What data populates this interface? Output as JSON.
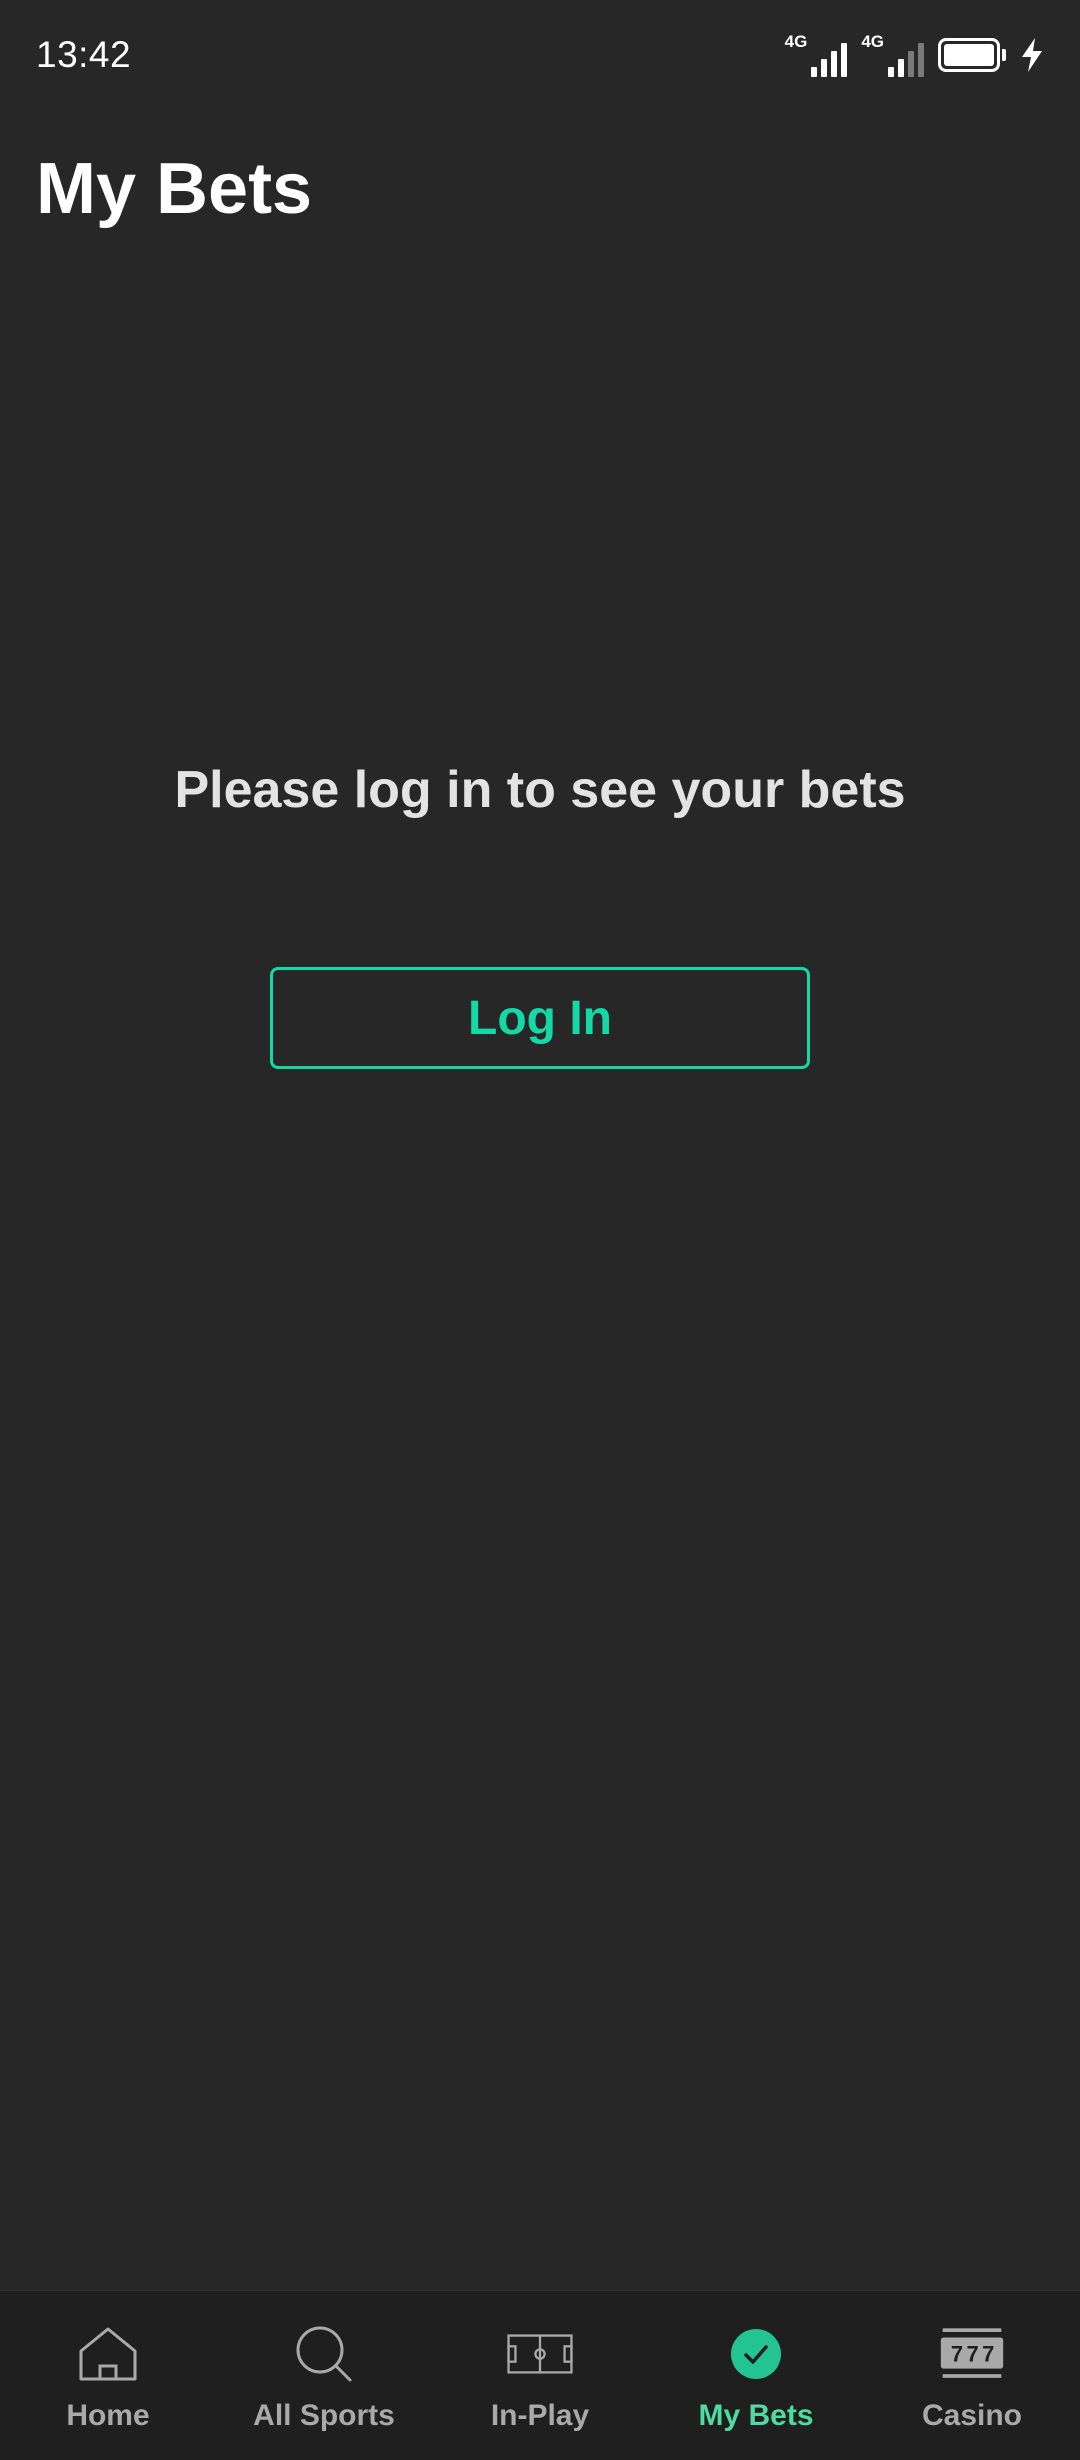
{
  "status_bar": {
    "time": "13:42",
    "network_1": "4G",
    "network_2": "4G"
  },
  "page": {
    "title": "My Bets",
    "prompt": "Please log in to see your bets",
    "login_label": "Log In"
  },
  "bottom_nav": {
    "items": [
      {
        "label": "Home",
        "icon": "home-icon"
      },
      {
        "label": "All Sports",
        "icon": "search-icon"
      },
      {
        "label": "In-Play",
        "icon": "pitch-icon"
      },
      {
        "label": "My Bets",
        "icon": "check-circle-icon",
        "active": true
      },
      {
        "label": "Casino",
        "icon": "slot-machine-icon"
      }
    ]
  },
  "colors": {
    "background": "#272727",
    "accent": "#14d8a6",
    "nav_background": "#1f1f1f",
    "nav_inactive": "#a9a9a9"
  }
}
